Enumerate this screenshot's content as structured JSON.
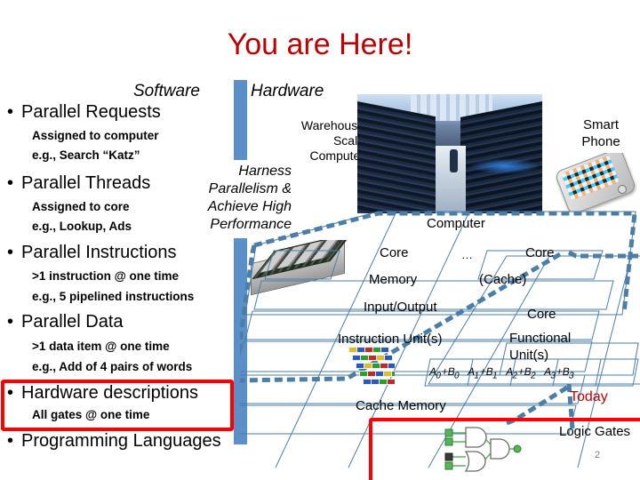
{
  "slide": {
    "title": "You are Here!",
    "page_number": "2",
    "colors": {
      "title_red": "#C00000",
      "highlight_red": "#FF0000",
      "divider_blue": "#5B8FC7",
      "outline_blue": "#4A7EA8"
    }
  },
  "columns": {
    "software_heading": "Software",
    "hardware_heading": "Hardware"
  },
  "bullets": [
    {
      "label": "Parallel Requests",
      "subs": [
        "Assigned to computer",
        "e.g., Search “Katz”"
      ]
    },
    {
      "label": "Parallel Threads",
      "subs": [
        "Assigned to core",
        "e.g., Lookup, Ads"
      ]
    },
    {
      "label": "Parallel Instructions",
      "subs": [
        ">1 instruction @ one time",
        "e.g., 5 pipelined instructions"
      ]
    },
    {
      "label": "Parallel Data",
      "subs": [
        ">1 data item @ one time",
        "e.g., Add of 4 pairs of words"
      ]
    },
    {
      "label": "Hardware descriptions",
      "subs": [
        "All gates @ one time"
      ]
    },
    {
      "label": "Programming Languages",
      "subs": []
    }
  ],
  "harness": {
    "line1": "Harness",
    "line2": "Parallelism &",
    "line3": "Achieve High",
    "line4": "Performance"
  },
  "hardware_labels": {
    "warehouse_scale_computer": "Warehouse\nScale\nComputer",
    "warehouse_l1": "Warehouse",
    "warehouse_l2": "Scale",
    "warehouse_l3": "Computer",
    "smart_phone_l1": "Smart",
    "smart_phone_l2": "Phone",
    "computer": "Computer",
    "core_left": "Core",
    "core_ellipsis": "…",
    "core_right": "Core",
    "memory": "Memory",
    "cache": "(Cache)",
    "input_output": "Input/Output",
    "instruction_units": "Instruction Unit(s)",
    "core_inner": "Core",
    "functional_units_l1": "Functional",
    "functional_units_l2": "Unit(s)",
    "cache_memory": "Cache Memory",
    "logic_gates": "Logic Gates",
    "today": "Today"
  },
  "adders": [
    {
      "a": "A",
      "asub": "0",
      "b": "B",
      "bsub": "0"
    },
    {
      "a": "A",
      "asub": "1",
      "b": "B",
      "bsub": "1"
    },
    {
      "a": "A",
      "asub": "2",
      "b": "B",
      "bsub": "2"
    },
    {
      "a": "A",
      "asub": "3",
      "b": "B",
      "bsub": "3"
    }
  ],
  "images": {
    "datacenter": "warehouse-scale-datacenter-photo",
    "smartphone": "smartphone-photo",
    "server": "server-blade-photo",
    "simd": "vector-data-grid-image",
    "gates": "logic-gate-schematic"
  }
}
